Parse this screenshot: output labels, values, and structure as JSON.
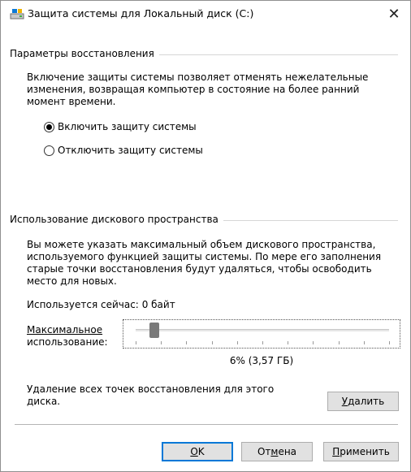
{
  "window": {
    "title": "Защита системы для Локальный диск (C:)",
    "close_glyph": "✕"
  },
  "restore": {
    "group_title": "Параметры восстановления",
    "description_lines": [
      "Включение защиты системы позволяет отменять нежелательные",
      "изменения, возвращая компьютер в состояние на более ранний",
      "момент времени."
    ],
    "option_enable": "Включить защиту системы",
    "option_disable": "Отключить защиту системы",
    "selected": "enable"
  },
  "disk": {
    "group_title": "Использование дискового пространства",
    "description_lines": [
      "Вы можете указать максимальный объем дискового пространства,",
      "используемого функцией защиты системы. По мере его заполнения",
      "старые точки восстановления будут удаляться, чтобы освободить",
      "место для новых."
    ],
    "current_usage_label": "Используется сейчас:",
    "current_usage_value": "0 байт",
    "max_usage_label_line1": "Максимальное",
    "max_usage_label_line2": "использование:",
    "slider_percent": 6,
    "slider_value_text": "6% (3,57 ГБ)",
    "delete_text_line1": "Удаление всех точек восстановления для этого",
    "delete_text_line2": "диска.",
    "delete_button_first": "У",
    "delete_button_rest": "далить"
  },
  "footer": {
    "ok_first": "О",
    "ok_rest": "K",
    "cancel_pre": "От",
    "cancel_u": "м",
    "cancel_post": "ена",
    "apply_first": "П",
    "apply_rest": "рименить"
  }
}
